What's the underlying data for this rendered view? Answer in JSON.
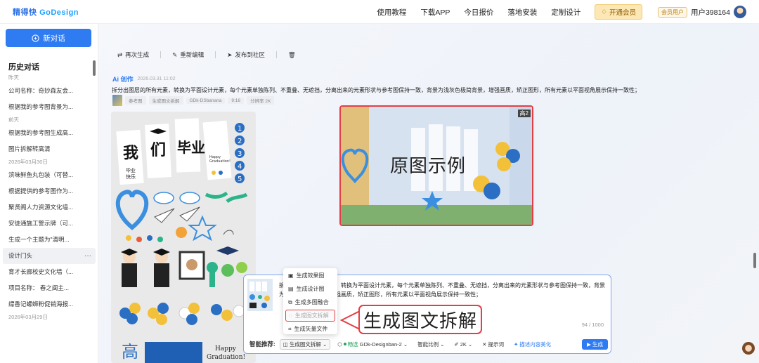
{
  "topbar": {
    "logo_main": "精得快",
    "logo_go": "GoDesign",
    "nav": [
      "使用教程",
      "下载APP",
      "今日报价",
      "落地安装",
      "定制设计"
    ],
    "vip": "开通会员",
    "member_badge": "会员用户",
    "username": "用户398164"
  },
  "sidebar": {
    "new_chat": "新对话",
    "title": "历史对话",
    "groups": [
      {
        "label": "昨天",
        "items": [
          "公司名称：奇妙森友会...",
          "根据我的参考图背景为..."
        ]
      },
      {
        "label": "前天",
        "items": [
          "根据我的参考图生成高...",
          "图片拆解转高清"
        ]
      },
      {
        "label": "2026年03月30日",
        "items": [
          "滨味鲜鱼丸包装（可替...",
          "根据提供的参考图作为...",
          "聚贤阁人力资源文化墙...",
          "安徒通施工警示牌（可...",
          "生成一个主题为\"清明...",
          "设计门头",
          "育才长廊校史文化墙（...",
          "项目名称： 春之闽主...",
          "缥香记螺蛳粉促销海报..."
        ]
      },
      {
        "label": "2026年03月29日",
        "items": []
      }
    ]
  },
  "toolbar": {
    "regenerate": "再次生成",
    "re_edit": "重新编辑",
    "publish": "发布到社区"
  },
  "message": {
    "ai_label": "创作",
    "timestamp": "2026.03.31 11:02",
    "prompt": "拆分出图层的所有元素，转换为平面设计元素，每个元素单独陈列、不重叠、无遮挡，分离出来的元素形状与参考图保持一致，背景为浅灰色极简背景，增强画质，矫正图形，所有元素以平面视角展示保持一致性；",
    "tags": [
      "参考图",
      "生成图文拆解",
      "GDk-DSbanana",
      "9:16",
      "分辨率 2K"
    ]
  },
  "sticker_sheet": {
    "chars": [
      "我",
      "们",
      "毕业"
    ],
    "sub1": "毕业\n快乐",
    "happy": "Happy\nGraduation!",
    "gao": "高",
    "numbers": [
      "1",
      "2",
      "3",
      "4",
      "5"
    ]
  },
  "original": {
    "label": "原图示例",
    "corner": "高2"
  },
  "input": {
    "text": "拆分出图层的所有元素，转换为平面设计元素，每个元素单独陈列、不重叠、无遮挡，分离出来的元素形状与参考图保持一致，背景为浅灰色极简背景，增强画质，矫正图形，所有元素以平面视角展示保持一致性；",
    "counter": "94 / 1000"
  },
  "bottom_bar": {
    "label": "智能推荐:",
    "mode": "生成图文拆解",
    "free": "畅选",
    "model": "GDk-Designban-2",
    "ratio": "智能比例",
    "resolution": "2K",
    "tips": "提示词",
    "describe": "描述内容美化",
    "generate": "生成"
  },
  "menu": {
    "items": [
      "生成效果图",
      "生成设计图",
      "生成多图融合",
      "生成图文拆解",
      "生成矢量文件"
    ]
  },
  "callout": {
    "label": "生成图文拆解"
  },
  "colors": {
    "primary": "#2e7bf2",
    "annotation_red": "#e33e45"
  }
}
